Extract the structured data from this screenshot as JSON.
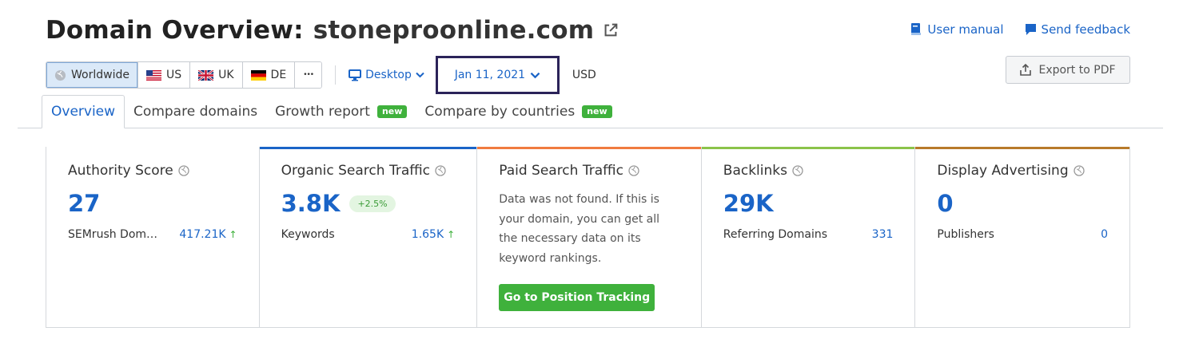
{
  "header": {
    "title_prefix": "Domain Overview:",
    "domain": "stoneproonline.com",
    "links": {
      "user_manual": "User manual",
      "send_feedback": "Send feedback"
    }
  },
  "toolbar": {
    "regions": [
      {
        "label": "Worldwide",
        "icon": "globe-icon",
        "active": true
      },
      {
        "label": "US",
        "icon": "us-flag-icon"
      },
      {
        "label": "UK",
        "icon": "uk-flag-icon"
      },
      {
        "label": "DE",
        "icon": "de-flag-icon"
      }
    ],
    "more_label": "•••",
    "device": "Desktop",
    "date": "Jan 11, 2021",
    "currency": "USD",
    "export_label": "Export to PDF"
  },
  "tabs": [
    {
      "label": "Overview",
      "active": true
    },
    {
      "label": "Compare domains"
    },
    {
      "label": "Growth report",
      "badge": "new"
    },
    {
      "label": "Compare by countries",
      "badge": "new"
    }
  ],
  "cards": {
    "authority": {
      "title": "Authority Score",
      "value": "27",
      "sub_label": "SEMrush Dom…",
      "sub_value": "417.21K",
      "sub_arrow": "↑"
    },
    "organic": {
      "title": "Organic Search Traffic",
      "value": "3.8K",
      "change": "+2.5%",
      "sub_label": "Keywords",
      "sub_value": "1.65K",
      "sub_arrow": "↑",
      "accent": "#1a64c7"
    },
    "paid": {
      "title": "Paid Search Traffic",
      "message": "Data was not found. If this is your domain, you can get all the necessary data on its keyword rankings.",
      "cta": "Go to Position Tracking",
      "accent": "#f07b3f"
    },
    "backlinks": {
      "title": "Backlinks",
      "value": "29K",
      "sub_label": "Referring Domains",
      "sub_value": "331",
      "accent": "#8bc34a"
    },
    "display": {
      "title": "Display Advertising",
      "value": "0",
      "sub_label": "Publishers",
      "sub_value": "0",
      "accent": "#b87a2a"
    }
  },
  "colors": {
    "link_blue": "#1a64c7",
    "green": "#3fb13c",
    "highlight_border": "#2b2359"
  }
}
